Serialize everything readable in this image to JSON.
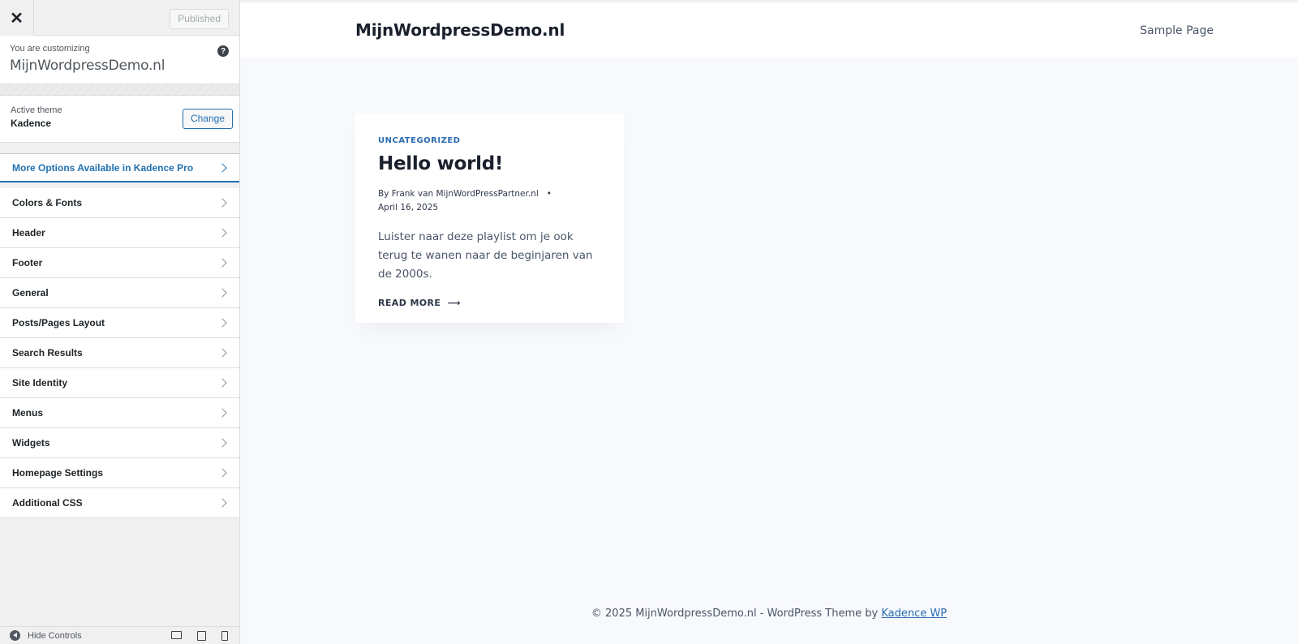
{
  "sidebar": {
    "close_icon": "close-icon",
    "publish_label": "Published",
    "customizing_label": "You are customizing",
    "site_name": "MijnWordpressDemo.nl",
    "active_theme_label": "Active theme",
    "theme_name": "Kadence",
    "change_label": "Change",
    "pro_item": "More Options Available in Kadence Pro",
    "menu_items": [
      "Colors & Fonts",
      "Header",
      "Footer",
      "General",
      "Posts/Pages Layout",
      "Search Results",
      "Site Identity",
      "Menus",
      "Widgets",
      "Homepage Settings",
      "Additional CSS"
    ],
    "hide_controls": "Hide Controls"
  },
  "preview": {
    "site_title": "MijnWordpressDemo.nl",
    "nav_link": "Sample Page",
    "post": {
      "category": "UNCATEGORIZED",
      "title": "Hello world!",
      "author_line": "By Frank van MijnWordPressPartner.nl",
      "date": "April 16, 2025",
      "excerpt": "Luister naar deze playlist om je ook terug te wanen naar de beginjaren van de 2000s.",
      "read_more": "READ MORE"
    },
    "footer": {
      "text": "© 2025 MijnWordpressDemo.nl - WordPress Theme by ",
      "link": "Kadence WP"
    }
  },
  "colors": {
    "accent": "#2271b1",
    "link": "#2b6cb0",
    "preview_bg": "#f7f9fc"
  }
}
